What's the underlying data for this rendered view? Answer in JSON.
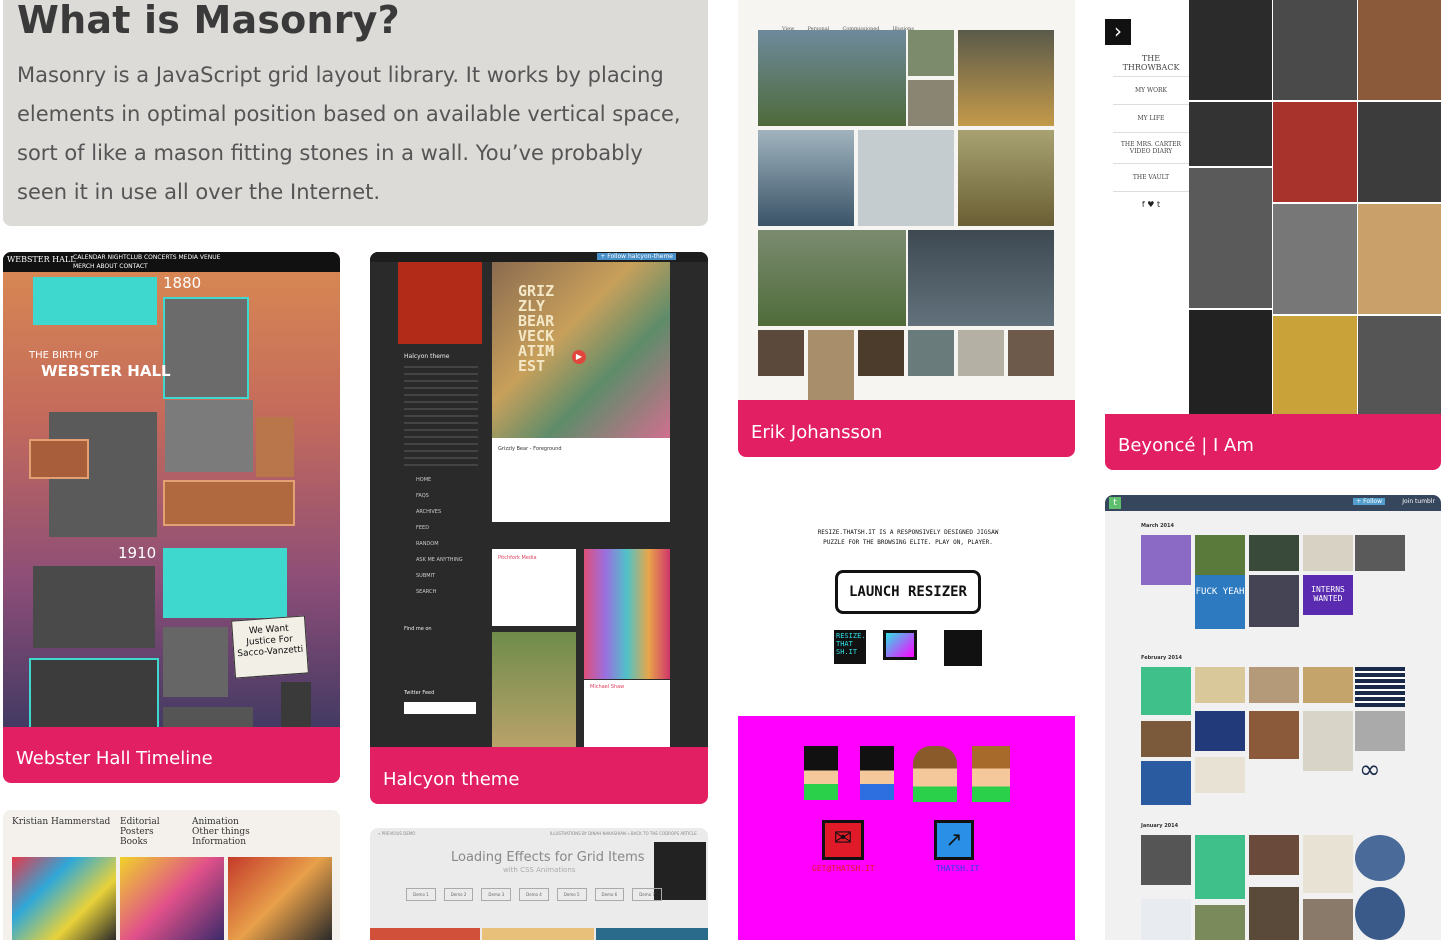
{
  "intro": {
    "title": "What is Masonry?",
    "body": "Masonry is a JavaScript grid layout library. It works by placing elements in optimal position based on available vertical space, sort of like a mason fitting stones in a wall. You’ve probably seen it in use all over the Internet."
  },
  "cards": {
    "webster": {
      "caption": "Webster Hall Timeline",
      "nav": "CALENDAR  NIGHTCLUB  CONCERTS  MEDIA  VENUE",
      "nav2": "MERCH  ABOUT  CONTACT",
      "year1": "1880",
      "year2": "1910",
      "heading_small": "THE BIRTH OF",
      "heading_big": "WEBSTER HALL",
      "sign": "We Want Justice For Sacco-Vanzetti"
    },
    "halcyon": {
      "caption": "Halcyon theme",
      "sidebar_title": "Halcyon theme",
      "poster_text": "GRIZ ZLY BEAR VECK ATIM EST",
      "post_title": "Grizzly Bear - Foreground",
      "follow": "+ Follow halcyon-theme",
      "nav_items": [
        "HOME",
        "FAQS",
        "ARCHIVES",
        "FEED",
        "RANDOM",
        "ASK ME ANYTHING",
        "SUBMIT",
        "SEARCH"
      ],
      "find_me": "Find me on",
      "twitter": "Twitter Feed",
      "post2_title": "Pitchfork Media",
      "post3_title": "Michael Shaw"
    },
    "erik": {
      "caption": "Erik Johansson",
      "nav": [
        "View",
        "Personal",
        "Commissioned",
        "Illusions"
      ]
    },
    "beyonce": {
      "caption": "Beyoncé | I Am",
      "menu": [
        "THE THROWBACK",
        "MY WORK",
        "MY LIFE",
        "THE MRS. CARTER VIDEO DIARY",
        "THE VAULT"
      ],
      "social": "f  ♥  t",
      "arrow": "›"
    },
    "resizer": {
      "tagline": "RESIZE.THATSH.IT IS A RESPONSIVELY DESIGNED JIGSAW PUZZLE FOR THE BROWSING ELITE. PLAY ON, PLAYER.",
      "button": "LAUNCH RESIZER",
      "tile_text": "RESIZE. THAT SH.IT",
      "email": "GET@THATSH.IT",
      "site": "THATSH.IT"
    },
    "tumblr": {
      "sections": [
        "March 2014",
        "February 2014",
        "January 2014"
      ],
      "follow": "+ Follow",
      "join": "Join tumblr",
      "tile_text1": "FUCK YEAH",
      "tile_text2": "INTERNS WANTED"
    },
    "kristian": {
      "name": "Kristian Hammerstad",
      "col1": [
        "Editorial",
        "Posters",
        "Books"
      ],
      "col2": [
        "Animation",
        "Other things",
        "Information"
      ]
    },
    "loading": {
      "title": "Loading Effects for Grid Items",
      "subtitle": "with CSS Animations",
      "buttons": [
        "Demo 1",
        "Demo 2",
        "Demo 3",
        "Demo 4",
        "Demo 5",
        "Demo 6",
        "Demo 7"
      ],
      "topleft": "« PREVIOUS DEMO",
      "topright": "ILLUSTRATIONS BY DINAH NAKASHIAN   « BACK TO THE CODROPS ARTICLE"
    }
  },
  "colors": {
    "accent": "#e21f63",
    "intro_bg": "#dcdbd8",
    "magenta": "#ff00ff",
    "teal": "#3fd8cf"
  }
}
